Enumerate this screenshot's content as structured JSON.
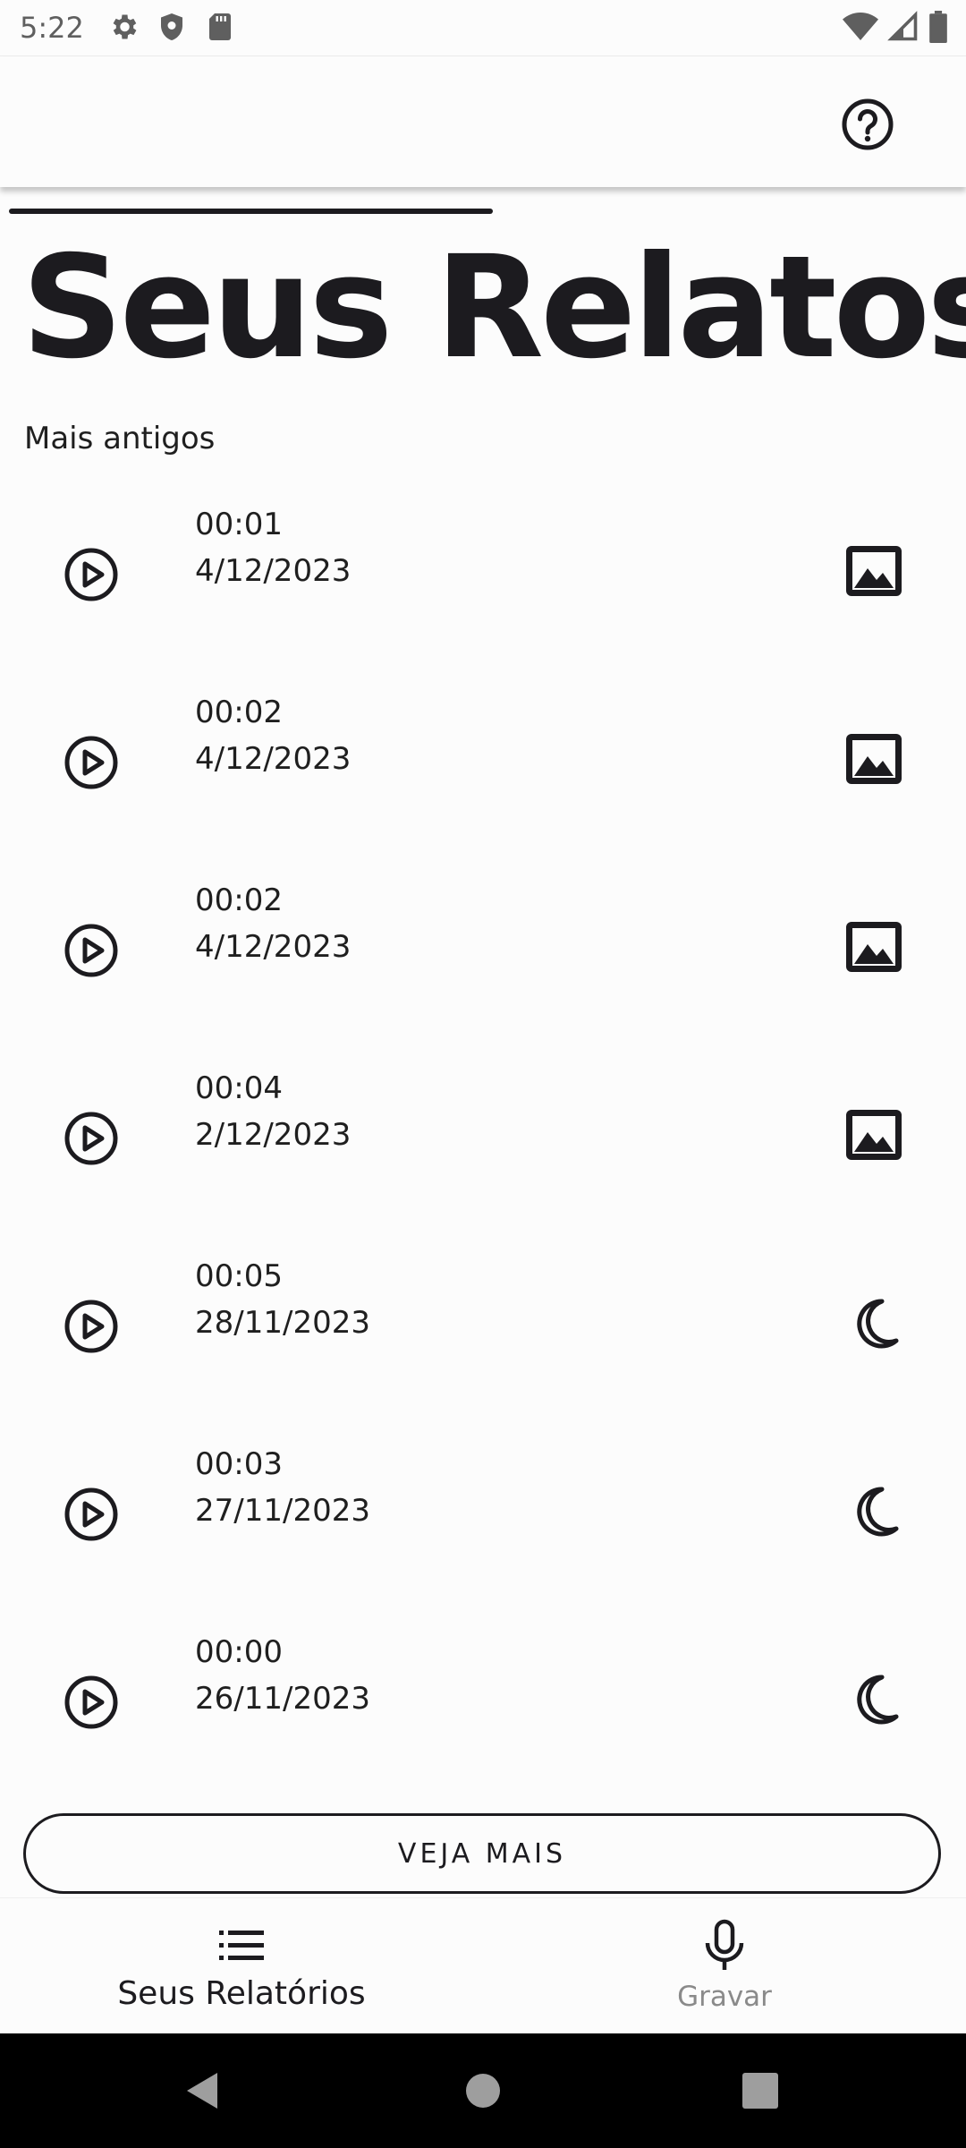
{
  "status_bar": {
    "time": "5:22"
  },
  "header": {
    "title": "Seus Relatos",
    "sort_label": "Mais antigos"
  },
  "reports": [
    {
      "duration": "00:01",
      "date": "4/12/2023",
      "icon": "image-icon"
    },
    {
      "duration": "00:02",
      "date": "4/12/2023",
      "icon": "image-icon"
    },
    {
      "duration": "00:02",
      "date": "4/12/2023",
      "icon": "image-icon"
    },
    {
      "duration": "00:04",
      "date": "2/12/2023",
      "icon": "image-icon"
    },
    {
      "duration": "00:05",
      "date": "28/11/2023",
      "icon": "moon-icon"
    },
    {
      "duration": "00:03",
      "date": "27/11/2023",
      "icon": "moon-icon"
    },
    {
      "duration": "00:00",
      "date": "26/11/2023",
      "icon": "moon-icon"
    }
  ],
  "more_button": {
    "label": "VEJA MAIS"
  },
  "bottom_nav": {
    "items": [
      {
        "label": "Seus Relatórios",
        "icon": "list-icon",
        "active": true
      },
      {
        "label": "Gravar",
        "icon": "microphone-icon",
        "active": false
      }
    ]
  },
  "colors": {
    "text": "#1c1b1f",
    "background": "#fcfcfc",
    "inactive": "#8a8a8a"
  }
}
